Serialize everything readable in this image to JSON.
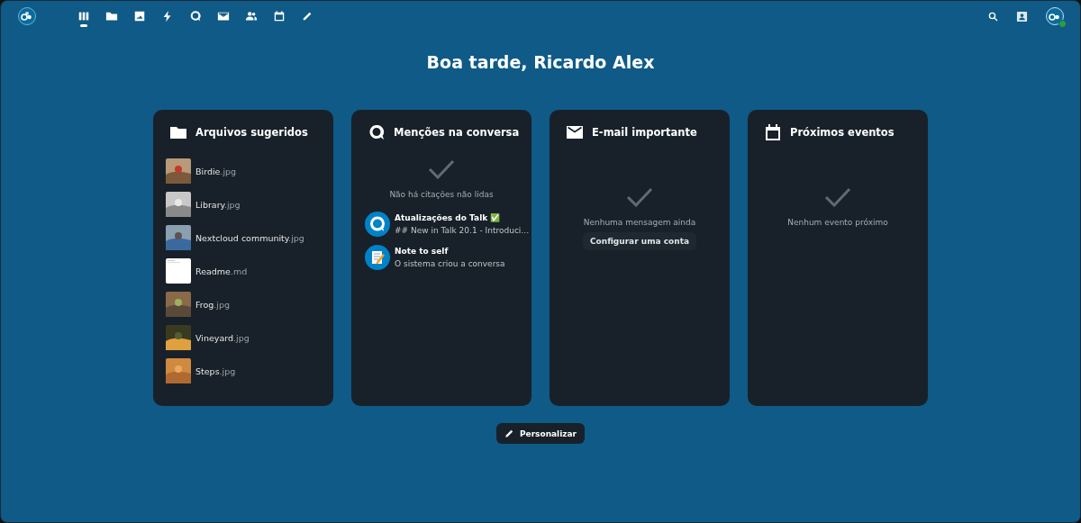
{
  "header": {
    "apps": [
      {
        "kind": "dashboard",
        "selected": true
      },
      {
        "kind": "files",
        "selected": false
      },
      {
        "kind": "photos",
        "selected": false
      },
      {
        "kind": "activity",
        "selected": false
      },
      {
        "kind": "talk",
        "selected": false
      },
      {
        "kind": "mail",
        "selected": false
      },
      {
        "kind": "contacts",
        "selected": false
      },
      {
        "kind": "calendar",
        "selected": false
      },
      {
        "kind": "notes",
        "selected": false
      }
    ],
    "user_online": true
  },
  "greeting": "Boa tarde, Ricardo Alex",
  "widgets": [
    {
      "kind": "files",
      "title": "Arquivos sugeridos",
      "items": [
        {
          "name": "Birdie",
          "extension": ".jpg",
          "kind": "picture"
        },
        {
          "name": "Library",
          "extension": ".jpg",
          "kind": "picture"
        },
        {
          "name": "Nextcloud community",
          "extension": ".jpg",
          "kind": "picture"
        },
        {
          "name": "Readme",
          "extension": ".md",
          "kind": "document"
        },
        {
          "name": "Frog",
          "extension": ".jpg",
          "kind": "picture"
        },
        {
          "name": "Vineyard",
          "extension": ".jpg",
          "kind": "picture"
        },
        {
          "name": "Steps",
          "extension": ".jpg",
          "kind": "picture"
        }
      ]
    },
    {
      "kind": "talk",
      "title": "Menções na conversa",
      "empty_text": "Não há citações não lidas",
      "items": [
        {
          "kind": "talk",
          "title": "Atualizações do Talk ✅",
          "subtitle": "## New in Talk 20.1 - Introduci…"
        },
        {
          "kind": "note",
          "title": "Note to self",
          "subtitle": "O sistema criou a conversa"
        }
      ]
    },
    {
      "kind": "mail",
      "title": "E-mail importante",
      "empty_text": "Nenhuma mensagem ainda",
      "action": "Configurar uma conta"
    },
    {
      "kind": "calendar",
      "title": "Próximos eventos",
      "empty_text": "Nenhum evento próximo"
    }
  ],
  "customize_button": "Personalizar"
}
